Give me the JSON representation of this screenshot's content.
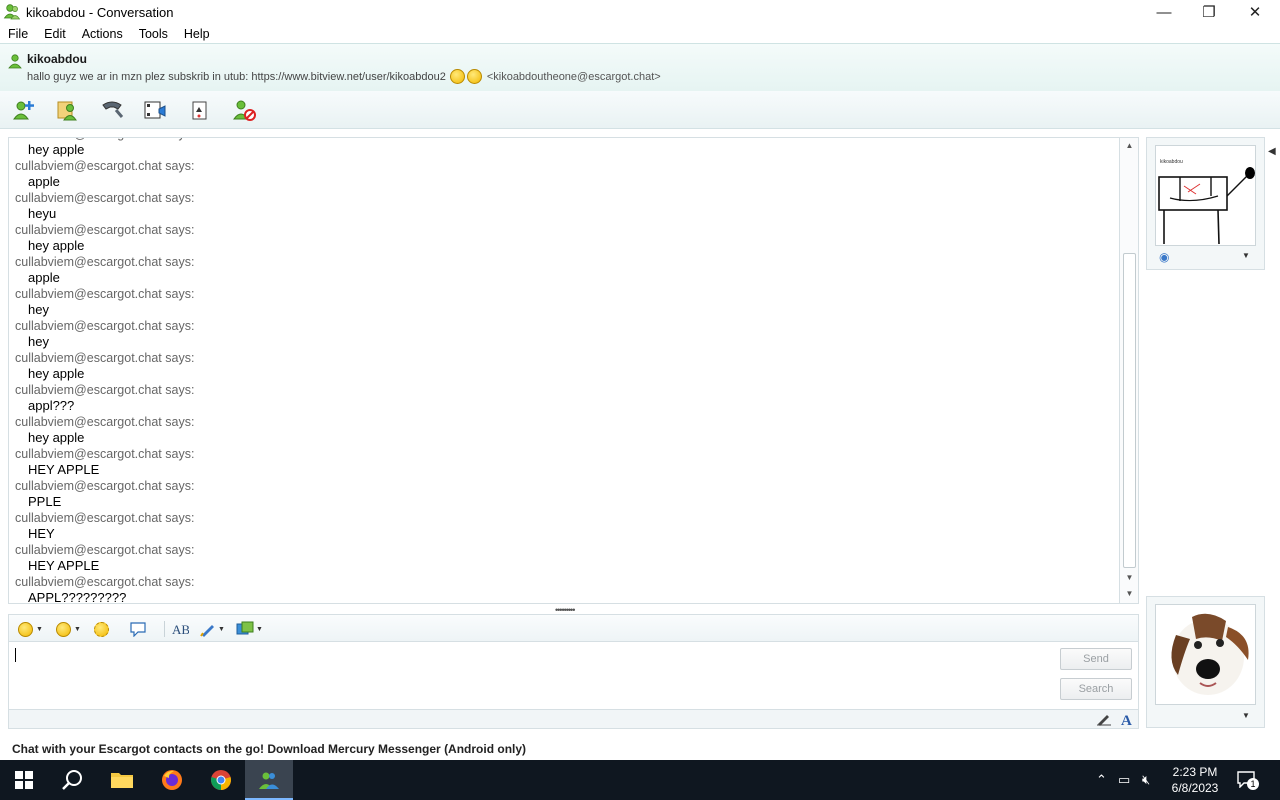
{
  "window": {
    "title": "kikoabdou - Conversation",
    "minimize": "—",
    "restore": "❐",
    "close": "✕"
  },
  "menu": [
    "File",
    "Edit",
    "Actions",
    "Tools",
    "Help"
  ],
  "contact": {
    "name": "kikoabdou",
    "psm": "hallo guyz we ar in mzn plez subskrib in utub: https://www.bitview.net/user/kikoabdou2",
    "email": "<kikoabdoutheone@escargot.chat>"
  },
  "toolbar_icons": [
    "invite-contact-icon",
    "share-files-icon",
    "call-icon",
    "video-icon",
    "activities-icon",
    "block-icon"
  ],
  "messages": [
    {
      "from": "cullabviem@escargot.chat says:",
      "text": "hey apple"
    },
    {
      "from": "cullabviem@escargot.chat says:",
      "text": "apple"
    },
    {
      "from": "cullabviem@escargot.chat says:",
      "text": "heyu"
    },
    {
      "from": "cullabviem@escargot.chat says:",
      "text": "hey apple"
    },
    {
      "from": "cullabviem@escargot.chat says:",
      "text": "apple"
    },
    {
      "from": "cullabviem@escargot.chat says:",
      "text": "hey"
    },
    {
      "from": "cullabviem@escargot.chat says:",
      "text": "hey"
    },
    {
      "from": "cullabviem@escargot.chat says:",
      "text": "hey apple"
    },
    {
      "from": "cullabviem@escargot.chat says:",
      "text": "appl???"
    },
    {
      "from": "cullabviem@escargot.chat says:",
      "text": "hey apple"
    },
    {
      "from": "cullabviem@escargot.chat says:",
      "text": "HEY APPLE"
    },
    {
      "from": "cullabviem@escargot.chat says:",
      "text": "PPLE"
    },
    {
      "from": "cullabviem@escargot.chat says:",
      "text": "HEY"
    },
    {
      "from": "cullabviem@escargot.chat says:",
      "text": "HEY APPLE"
    },
    {
      "from": "cullabviem@escargot.chat says:",
      "text": "APPL?????????"
    }
  ],
  "compose": {
    "value": "",
    "send_label": "Send",
    "search_label": "Search"
  },
  "display_picture": {
    "caption": "kikoabdou"
  },
  "promo": "Chat with your Escargot contacts on the go! Download Mercury Messenger (Android only)",
  "taskbar": {
    "time": "2:23 PM",
    "date": "6/8/2023",
    "notifications": "1"
  },
  "colors": {
    "header_bg": "#e6f4f2",
    "border": "#d6dfe3",
    "taskbar_bg": "#0f1720",
    "accent": "#7cb8ff"
  }
}
